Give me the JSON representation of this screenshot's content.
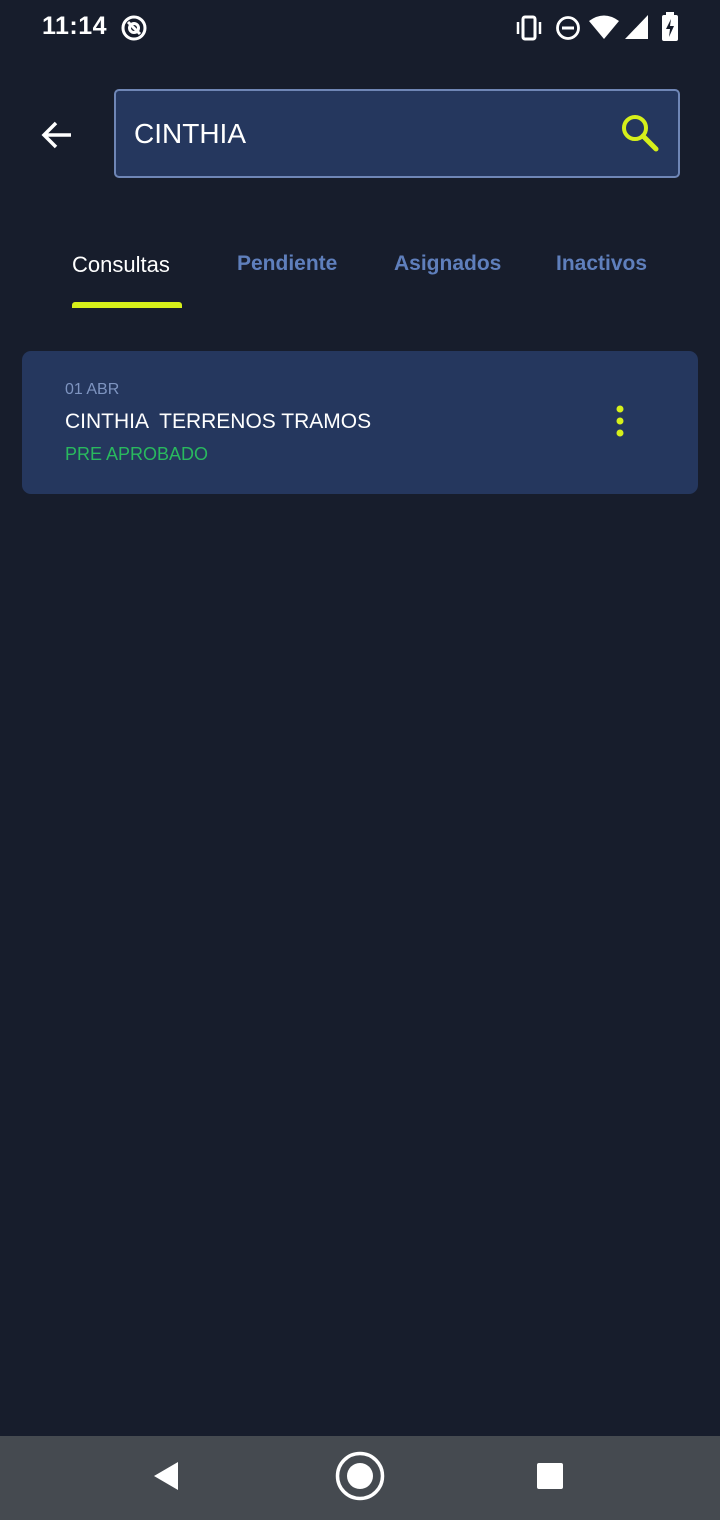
{
  "status_bar": {
    "time": "11:14",
    "icons": [
      "at-sign-icon",
      "vibrate-icon",
      "do-not-disturb-icon",
      "wifi-icon",
      "signal-icon",
      "battery-charging-icon"
    ]
  },
  "header": {
    "back_icon": "arrow-left-icon",
    "search": {
      "value": "CINTHIA",
      "placeholder": "",
      "icon": "search-icon"
    }
  },
  "tabs": [
    {
      "label": "Consultas",
      "active": true
    },
    {
      "label": "Pendiente",
      "active": false
    },
    {
      "label": "Asignados",
      "active": false
    },
    {
      "label": "Inactivos",
      "active": false
    }
  ],
  "results": [
    {
      "date": "01 ABR",
      "title": "CINTHIA  TERRENOS TRAMOS",
      "status": "PRE APROBADO",
      "menu_icon": "more-vertical-icon"
    }
  ],
  "navigation": {
    "icons": [
      "back-triangle-icon",
      "home-circle-icon",
      "recents-square-icon"
    ]
  },
  "colors": {
    "background": "#171d2c",
    "surface": "#25375e",
    "accent": "#d6ef1a",
    "tab_inactive": "#5f7fbc",
    "status_approved": "#29b95e",
    "nav_bar": "#454a50"
  }
}
